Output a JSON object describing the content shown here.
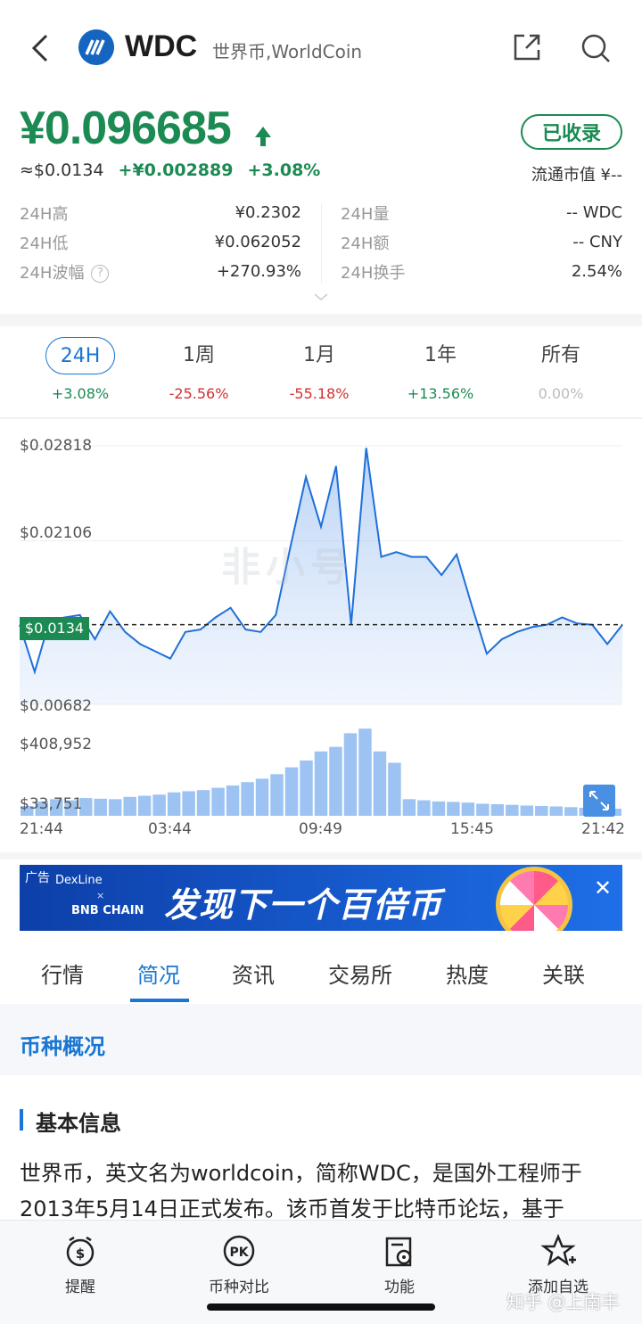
{
  "header": {
    "symbol": "WDC",
    "name": "世界币,WorldCoin"
  },
  "quote": {
    "price": "¥0.096685",
    "usd_price": "≈$0.0134",
    "change_abs": "+¥0.002889",
    "change_pct": "+3.08%",
    "collected_label": "已收录",
    "market_cap": "流通市值 ¥--"
  },
  "stats_left": [
    {
      "label": "24H高",
      "value": "¥0.2302"
    },
    {
      "label": "24H低",
      "value": "¥0.062052"
    },
    {
      "label": "24H波幅",
      "value": "+270.93%"
    }
  ],
  "stats_right": [
    {
      "label": "24H量",
      "value": "-- WDC"
    },
    {
      "label": "24H额",
      "value": "-- CNY"
    },
    {
      "label": "24H换手",
      "value": "2.54%"
    }
  ],
  "periods": [
    {
      "label": "24H",
      "pct": "+3.08%",
      "trend": "up"
    },
    {
      "label": "1周",
      "pct": "-25.56%",
      "trend": "down"
    },
    {
      "label": "1月",
      "pct": "-55.18%",
      "trend": "down"
    },
    {
      "label": "1年",
      "pct": "+13.56%",
      "trend": "up"
    },
    {
      "label": "所有",
      "pct": "0.00%",
      "trend": "flat"
    }
  ],
  "chart": {
    "y_ticks": [
      "$0.02818",
      "$0.02106",
      "$0.00682"
    ],
    "current_tag": "$0.0134",
    "volume_ticks": [
      "$408,952",
      "$33,751"
    ],
    "x_ticks": [
      "21:44",
      "03:44",
      "09:49",
      "15:45",
      "21:42"
    ],
    "watermark": "非小号"
  },
  "chart_data": {
    "type": "area",
    "title": "",
    "xlabel": "",
    "ylabel": "",
    "x": [
      "21:44",
      "03:44",
      "09:49",
      "15:45",
      "21:42"
    ],
    "ylim": [
      0.00682,
      0.02818
    ],
    "series": [
      {
        "values": [
          0.0134,
          0.0095,
          0.0138,
          0.014,
          0.0142,
          0.0122,
          0.0145,
          0.0128,
          0.0118,
          0.0112,
          0.0106,
          0.0128,
          0.013,
          0.014,
          0.0148,
          0.013,
          0.0128,
          0.0142,
          0.02,
          0.0256,
          0.0215,
          0.0265,
          0.0134,
          0.028,
          0.019,
          0.0194,
          0.019,
          0.019,
          0.0175,
          0.0192,
          0.015,
          0.011,
          0.0122,
          0.0128,
          0.0132,
          0.0134,
          0.014,
          0.0135,
          0.0134,
          0.0118,
          0.0134
        ]
      }
    ],
    "volume_ylim": [
      33751,
      408952
    ],
    "volume": [
      60000,
      80000,
      90000,
      85000,
      95000,
      92000,
      90000,
      100000,
      105000,
      110000,
      120000,
      125000,
      130000,
      140000,
      150000,
      165000,
      180000,
      200000,
      230000,
      260000,
      300000,
      320000,
      380000,
      400000,
      300000,
      250000,
      90000,
      85000,
      80000,
      78000,
      75000,
      70000,
      68000,
      65000,
      62000,
      60000,
      58000,
      55000,
      52000,
      50000,
      48000
    ]
  },
  "ad": {
    "tag": "广告",
    "brand1": "DexLine",
    "brand2": "BNB CHAIN",
    "cross": "×",
    "headline": "发现下一个百倍币"
  },
  "section_tabs": [
    "行情",
    "简况",
    "资讯",
    "交易所",
    "热度",
    "关联"
  ],
  "content": {
    "overview_title": "币种概况",
    "basic_title": "基本信息",
    "description": "世界币，英文名为worldcoin，简称WDC，是国外工程师于2013年5月14日正式发布。该币首发于比特币论坛，基于"
  },
  "bottom_bar": [
    {
      "label": "提醒",
      "icon": "alarm-icon"
    },
    {
      "label": "币种对比",
      "icon": "pk-icon"
    },
    {
      "label": "功能",
      "icon": "function-icon"
    },
    {
      "label": "添加自选",
      "icon": "star-plus-icon"
    }
  ],
  "watermark_zhihu": "知乎 @上南丰"
}
